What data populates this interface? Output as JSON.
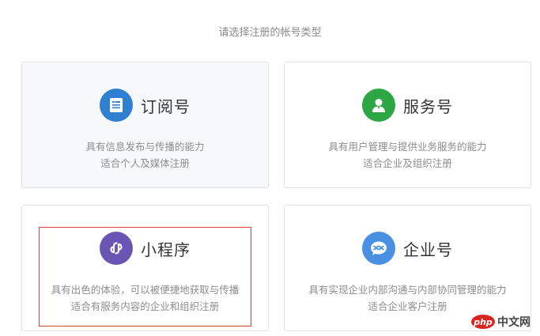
{
  "prompt": "请选择注册的帐号类型",
  "cards": [
    {
      "title": "订阅号",
      "icon": "document-icon",
      "color": "#2f80d1",
      "desc_line1": "具有信息发布与传播的能力",
      "desc_line2": "适合个人及媒体注册"
    },
    {
      "title": "服务号",
      "icon": "user-icon",
      "color": "#2ca744",
      "desc_line1": "具有用户管理与提供业务服务的能力",
      "desc_line2": "适合企业及组织注册"
    },
    {
      "title": "小程序",
      "icon": "link-icon",
      "color": "#6a55b4",
      "desc_line1": "具有出色的体验，可以被便捷地获取与传播",
      "desc_line2": "适合有服务内容的企业和组织注册"
    },
    {
      "title": "企业号",
      "icon": "chat-icon",
      "color": "#4a90e2",
      "desc_line1": "具有实现企业内部沟通与内部协同管理的能力",
      "desc_line2": "适合企业客户注册"
    }
  ],
  "watermark": {
    "logo": "php",
    "text": "中文网",
    "color": "#d7261f"
  }
}
